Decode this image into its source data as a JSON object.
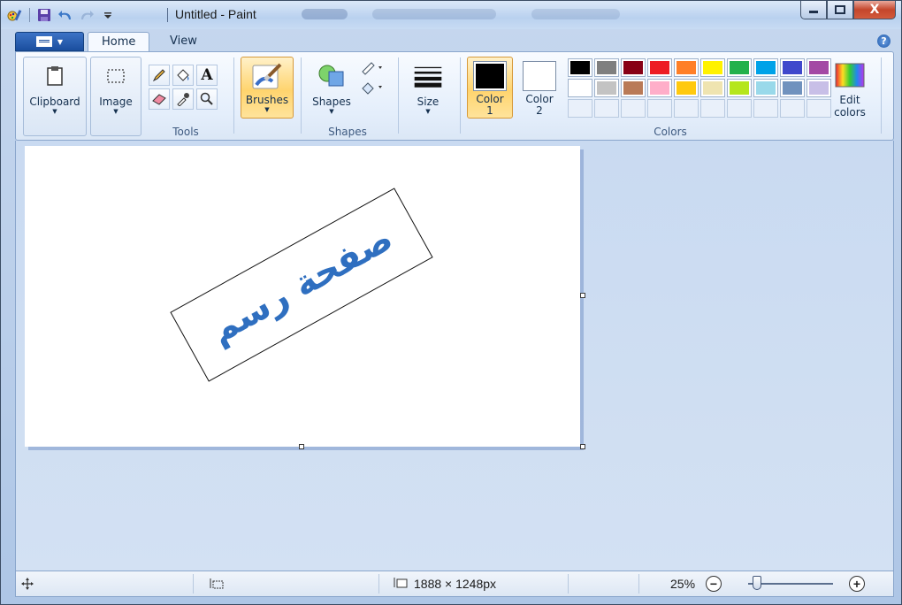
{
  "window": {
    "title": "Untitled - Paint",
    "controls": {
      "minimize": "—",
      "maximize": "□",
      "close": "X"
    }
  },
  "tabs": [
    {
      "label": "Home",
      "active": true
    },
    {
      "label": "View",
      "active": false
    }
  ],
  "ribbon": {
    "clipboard": {
      "label": "Clipboard"
    },
    "image": {
      "label": "Image"
    },
    "tools": {
      "group_label": "Tools",
      "items": [
        "pencil-icon",
        "fill-icon",
        "text-icon",
        "eraser-icon",
        "color-picker-icon",
        "magnifier-icon"
      ],
      "text_glyph": "A"
    },
    "brushes": {
      "label": "Brushes"
    },
    "shapes": {
      "label": "Shapes",
      "group_label": "Shapes"
    },
    "size": {
      "label": "Size"
    },
    "color1": {
      "label_line1": "Color",
      "label_line2": "1",
      "value": "#000000"
    },
    "color2": {
      "label_line1": "Color",
      "label_line2": "2",
      "value": "#ffffff"
    },
    "colors_group_label": "Colors",
    "edit_colors": {
      "label_line1": "Edit",
      "label_line2": "colors"
    },
    "palette_row1": [
      "#000000",
      "#7f7f7f",
      "#880015",
      "#ed1c24",
      "#ff7f27",
      "#fff200",
      "#22b14c",
      "#00a2e8",
      "#3f48cc",
      "#a349a4"
    ],
    "palette_row2": [
      "#ffffff",
      "#c3c3c3",
      "#b97a57",
      "#ffaec9",
      "#ffc90e",
      "#efe4b0",
      "#b5e61d",
      "#99d9ea",
      "#7092be",
      "#c8bfe7"
    ],
    "palette_row3_count": 10
  },
  "canvas": {
    "drawn_text": "صفحة رسم",
    "text_color": "#2f6fc0"
  },
  "statusbar": {
    "image_size": "1888 × 1248px",
    "zoom": "25%",
    "zoom_fraction": 0.1
  }
}
